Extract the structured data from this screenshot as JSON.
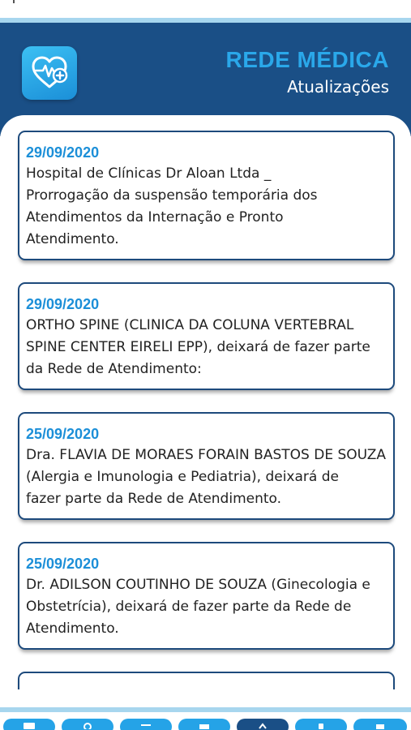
{
  "app": {
    "title": "REDE MÉDICA",
    "subtitle": "Atualizações",
    "logo_icon": "heart-pulse-plus-icon"
  },
  "colors": {
    "header_bg": "#1a4f86",
    "title_blue": "#2aa8ea",
    "date_blue": "#1c8fd8",
    "card_border": "#1d4a7c",
    "tab_blue": "#25a3e7"
  },
  "updates": [
    {
      "date": "29/09/2020",
      "lines": [
        "Hospital de Clínicas Dr Aloan Ltda _",
        "Prorrogação da suspensão temporária dos",
        "Atendimentos da Internação e Pronto",
        "Atendimento."
      ]
    },
    {
      "date": "29/09/2020",
      "lines": [
        "ORTHO SPINE (CLINICA DA COLUNA VERTEBRAL",
        "SPINE CENTER EIRELI EPP), deixará de fazer parte",
        "da Rede de Atendimento:"
      ]
    },
    {
      "date": "25/09/2020",
      "lines": [
        "Dra. FLAVIA DE MORAES FORAIN BASTOS DE SOUZA",
        "(Alergia e Imunologia e Pediatria), deixará de",
        "fazer parte da Rede de Atendimento."
      ]
    },
    {
      "date": "25/09/2020",
      "lines": [
        "Dr. ADILSON COUTINHO DE SOUZA (Ginecologia e",
        "Obstetrícia), deixará de fazer parte da Rede de",
        "Atendimento."
      ]
    },
    {
      "date": "",
      "lines": []
    }
  ],
  "tabs": [
    {
      "icon": "card-icon"
    },
    {
      "icon": "search-icon"
    },
    {
      "icon": "list-icon"
    },
    {
      "icon": "calendar-icon"
    },
    {
      "icon": "updates-icon",
      "active": true
    },
    {
      "icon": "phone-icon"
    },
    {
      "icon": "menu-icon"
    }
  ]
}
